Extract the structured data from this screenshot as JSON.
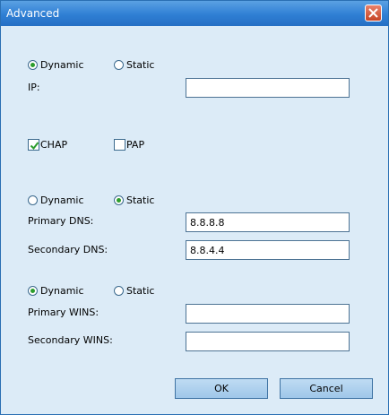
{
  "window": {
    "title": "Advanced",
    "close_icon": "close-icon",
    "close_color": "#d65a3f"
  },
  "ip_section": {
    "dynamic_label": "Dynamic",
    "static_label": "Static",
    "selected": "Dynamic",
    "ip_label": "IP:",
    "ip_value": ""
  },
  "auth_section": {
    "chap_label": "CHAP",
    "chap_checked": true,
    "pap_label": "PAP",
    "pap_checked": false
  },
  "dns_section": {
    "dynamic_label": "Dynamic",
    "static_label": "Static",
    "selected": "Static",
    "primary_label": "Primary DNS:",
    "primary_value": "8.8.8.8",
    "secondary_label": "Secondary DNS:",
    "secondary_value": "8.8.4.4"
  },
  "wins_section": {
    "dynamic_label": "Dynamic",
    "static_label": "Static",
    "selected": "Dynamic",
    "primary_label": "Primary WINS:",
    "primary_value": "",
    "secondary_label": "Secondary WINS:",
    "secondary_value": ""
  },
  "buttons": {
    "ok_label": "OK",
    "cancel_label": "Cancel"
  },
  "colors": {
    "titlebar": "#2f7fd4",
    "client_bg": "#dcebf7",
    "radio_dot": "#2c9d2c"
  }
}
